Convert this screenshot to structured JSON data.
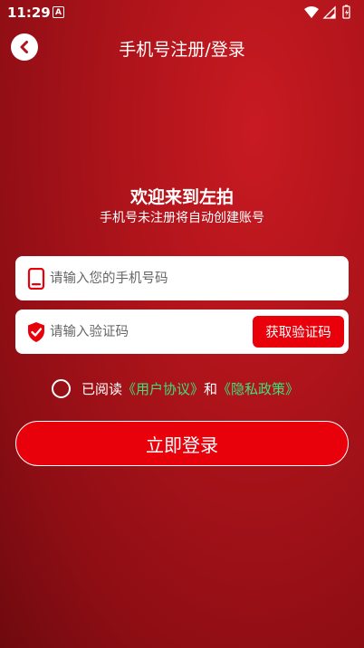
{
  "status_bar": {
    "time": "11:29",
    "notification_letter": "A",
    "icons": [
      "wifi-icon",
      "signal-icon",
      "battery-icon"
    ]
  },
  "header": {
    "back_icon": "chevron-left-icon",
    "title": "手机号注册/登录"
  },
  "welcome": {
    "title": "欢迎来到左拍",
    "subtitle": "手机号未注册将自动创建账号"
  },
  "phone_field": {
    "icon": "phone-icon",
    "placeholder": "请输入您的手机号码",
    "value": ""
  },
  "code_field": {
    "icon": "shield-check-icon",
    "placeholder": "请输入验证码",
    "value": "",
    "get_code_label": "获取验证码"
  },
  "agreement": {
    "checked": false,
    "prefix": "已阅读",
    "user_agreement": "《用户协议》",
    "conjunction": "和",
    "privacy_policy": "《隐私政策》"
  },
  "login_button": {
    "label": "立即登录"
  },
  "colors": {
    "background": "#b0141b",
    "accent_red": "#e8000b",
    "link_green": "#3ee07a",
    "field_bg": "#ffffff"
  }
}
